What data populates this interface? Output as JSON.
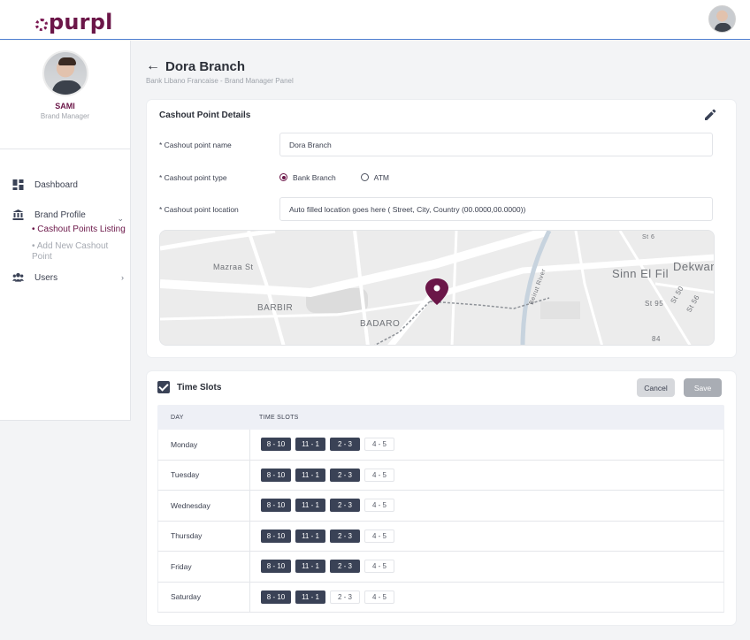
{
  "brand": {
    "logo_text": "purpl",
    "accent": "#6b1648",
    "dark": "#3a4256"
  },
  "user": {
    "name": "SAMI",
    "role": "Brand Manager"
  },
  "nav": {
    "dashboard": "Dashboard",
    "brand_profile": "Brand Profile",
    "sub_items": [
      "Cashout Points Listing",
      "Add New Cashout Point"
    ],
    "users": "Users"
  },
  "page": {
    "title": "Dora Branch",
    "subtitle": "Bank Libano Francaise - Brand Manager Panel"
  },
  "details": {
    "title": "Cashout Point Details",
    "name_label": "* Cashout point name",
    "name_value": "Dora Branch",
    "type_label": "* Cashout point type",
    "type_options": [
      "Bank Branch",
      "ATM"
    ],
    "type_selected": "Bank Branch",
    "location_label": "* Cashout point location",
    "location_value": "Auto filled location goes here ( Street, City, Country (00.0000,00.0000))"
  },
  "map": {
    "labels": [
      "Mazraa St",
      "BARBIR",
      "BADARO",
      "Sinn El Fil",
      "Dekwan",
      "Beirut River",
      "St 6",
      "St 95",
      "St 50",
      "St 56",
      "84"
    ]
  },
  "time_slots": {
    "title": "Time Slots",
    "enabled": true,
    "cancel_label": "Cancel",
    "save_label": "Save",
    "col_day": "DAY",
    "col_slots": "TIME SLOTS",
    "slot_labels": [
      "8 - 10",
      "11 - 1",
      "2 - 3",
      "4 - 5"
    ],
    "rows": [
      {
        "day": "Monday",
        "active": [
          true,
          true,
          true,
          false
        ]
      },
      {
        "day": "Tuesday",
        "active": [
          true,
          true,
          true,
          false
        ]
      },
      {
        "day": "Wednesday",
        "active": [
          true,
          true,
          true,
          false
        ]
      },
      {
        "day": "Thursday",
        "active": [
          true,
          true,
          true,
          false
        ]
      },
      {
        "day": "Friday",
        "active": [
          true,
          true,
          true,
          false
        ]
      },
      {
        "day": "Saturday",
        "active": [
          true,
          true,
          false,
          false
        ]
      }
    ]
  }
}
